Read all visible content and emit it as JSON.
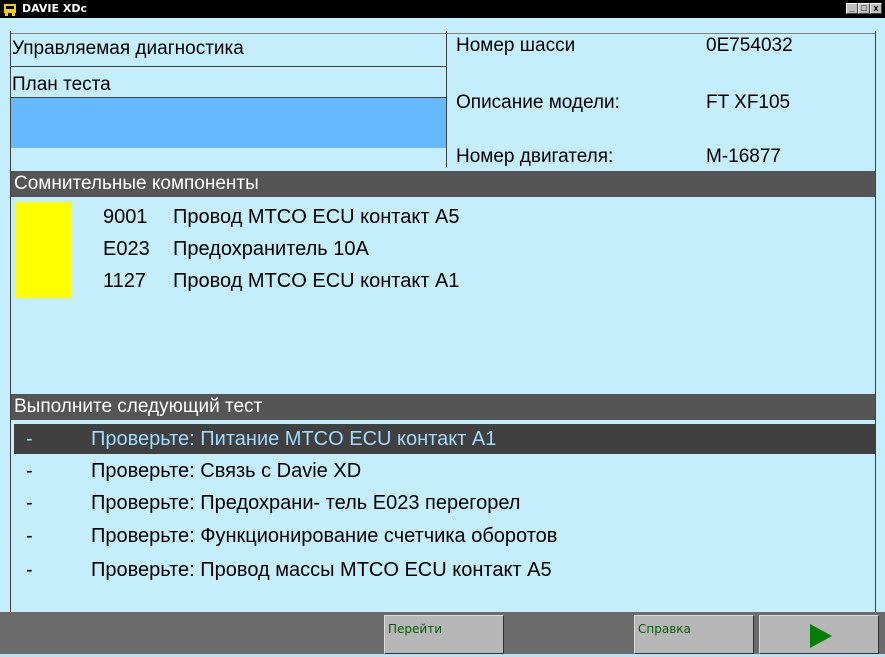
{
  "window": {
    "title": "DAVIE XDc",
    "controls": [
      "_",
      "□",
      "x"
    ]
  },
  "header": {
    "mode": "Управляемая диагностика",
    "plan": "План теста",
    "fields": [
      {
        "label": "Номер шасси",
        "value": "0E754032"
      },
      {
        "label": "Описание модели:",
        "value": "FT XF105"
      },
      {
        "label": "Номер двигателя:",
        "value": "M-16877"
      }
    ]
  },
  "components": {
    "title": "Сомнительные компоненты",
    "items": [
      {
        "code": "9001",
        "text": "Провод MTCO ECU контакт A5"
      },
      {
        "code": "E023",
        "text": "Предохранитель 10A"
      },
      {
        "code": "1127",
        "text": "Провод MTCO ECU контакт A1"
      }
    ]
  },
  "tests": {
    "title": "Выполните следующий тест",
    "items": [
      {
        "dash": "-",
        "text": "Проверьте: Питание MTCO ECU контакт A1"
      },
      {
        "dash": "-",
        "text": "Проверьте: Связь с Davie XD"
      },
      {
        "dash": "-",
        "text": "Проверьте: Предохрани- тель E023 перегорел"
      },
      {
        "dash": "-",
        "text": "Проверьте: Функционирование счетчика оборотов"
      },
      {
        "dash": "-",
        "text": "Проверьте: Провод массы MTCO ECU контакт A5"
      }
    ],
    "selected_index": 0
  },
  "footer": {
    "goto_label": "Перейти",
    "help_label": "Справка",
    "next_icon": "play-arrow-icon"
  },
  "colors": {
    "background": "#c4eefc",
    "highlight_blue": "#66b8ff",
    "marker_yellow": "#ffff00",
    "header_gray": "#555555",
    "button_text_green": "#006000"
  }
}
